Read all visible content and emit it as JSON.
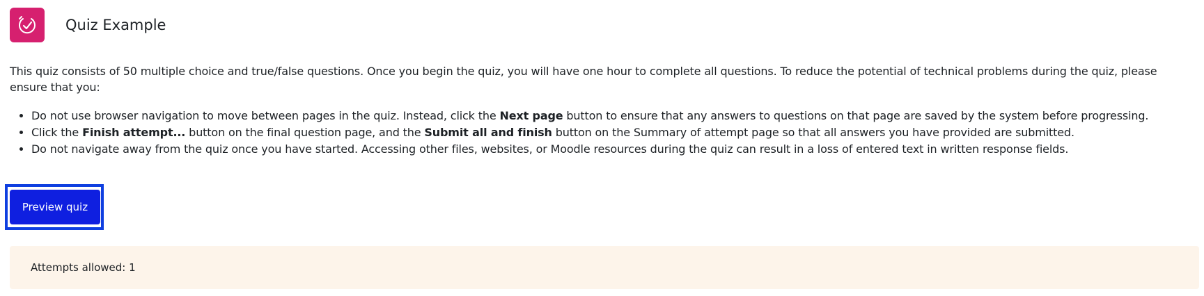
{
  "header": {
    "title": "Quiz Example",
    "icon": "quiz-activity-icon",
    "icon_color": "#d6206f"
  },
  "intro": {
    "text": "This quiz consists of 50 multiple choice and true/false questions. Once you begin the quiz, you will have one hour to complete all questions. To reduce the potential of technical problems during the quiz, please ensure that you:"
  },
  "rules": [
    {
      "t1": "Do not use browser navigation to move between pages in the quiz. Instead, click the ",
      "b1": "Next page",
      "t2": " button to ensure that any answers to questions on that page are saved by the system before progressing.",
      "b2": "",
      "t3": ""
    },
    {
      "t1": "Click the ",
      "b1": "Finish attempt...",
      "t2": " button on the final question page, and the ",
      "b2": "Submit all and finish",
      "t3": " button on the Summary of attempt page so that all answers you have provided are submitted."
    },
    {
      "t1": "Do not navigate away from the quiz once you have started. Accessing other files, websites, or Moodle resources during the quiz can result in a loss of entered text in written response fields.",
      "b1": "",
      "t2": "",
      "b2": "",
      "t3": ""
    }
  ],
  "actions": {
    "preview_label": "Preview quiz",
    "button_color": "#0f1fe0"
  },
  "info": {
    "attempts_text": "Attempts allowed: 1",
    "box_color": "#fdf4ea"
  }
}
